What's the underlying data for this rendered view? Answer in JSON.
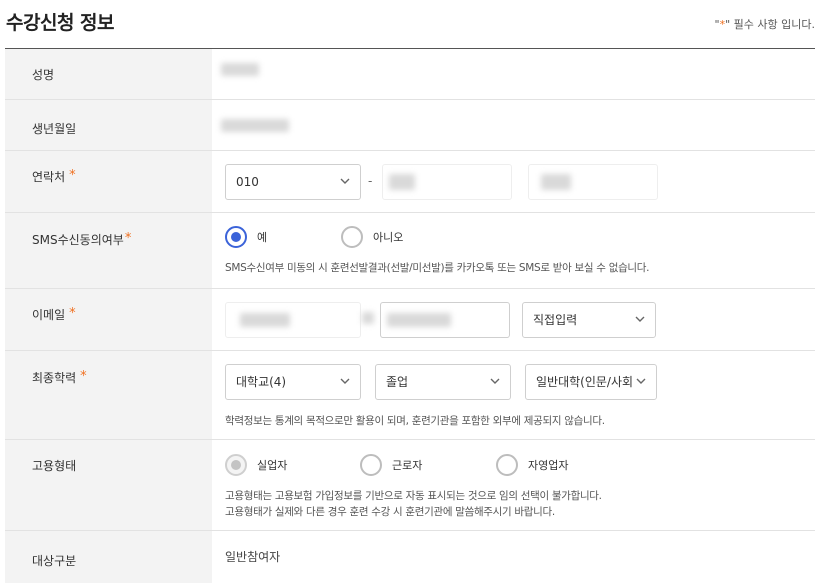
{
  "header": {
    "title": "수강신청 정보",
    "required_prefix": "\"",
    "required_star": "*",
    "required_suffix": "\" 필수 사항 입니다."
  },
  "rows": {
    "name": {
      "label": "성명"
    },
    "birth": {
      "label": "생년월일"
    },
    "phone": {
      "label": "연락처",
      "star": "*",
      "prefix_value": "010",
      "dash": "-"
    },
    "sms": {
      "label": "SMS수신동의여부",
      "star": "*",
      "options": [
        "예",
        "아니오"
      ],
      "selected": "예",
      "help": "SMS수신여부 미동의 시 훈련선발결과(선발/미선발)를 카카오톡 또는 SMS로 받아 보실 수 없습니다."
    },
    "email": {
      "label": "이메일",
      "star": "*",
      "domain_select": "직접입력"
    },
    "education": {
      "label": "최종학력",
      "star": "*",
      "level": "대학교(4)",
      "status": "졸업",
      "type": "일반대학(인문/사회",
      "help": "학력정보는 통계의 목적으로만 활용이 되며, 훈련기관을 포함한 외부에 제공되지 않습니다."
    },
    "employment": {
      "label": "고용형태",
      "options": [
        "실업자",
        "근로자",
        "자영업자"
      ],
      "selected": "실업자",
      "help1": "고용형태는 고용보험 가입정보를 기반으로 자동 표시되는 것으로 임의 선택이 불가합니다.",
      "help2": "고용형태가 실제와 다른 경우 훈련 수강 시 훈련기관에 말씀해주시기 바랍니다."
    },
    "target": {
      "label": "대상구분",
      "value": "일반참여자"
    }
  },
  "colors": {
    "accent": "#3b63d9",
    "required_star": "#f07020"
  }
}
